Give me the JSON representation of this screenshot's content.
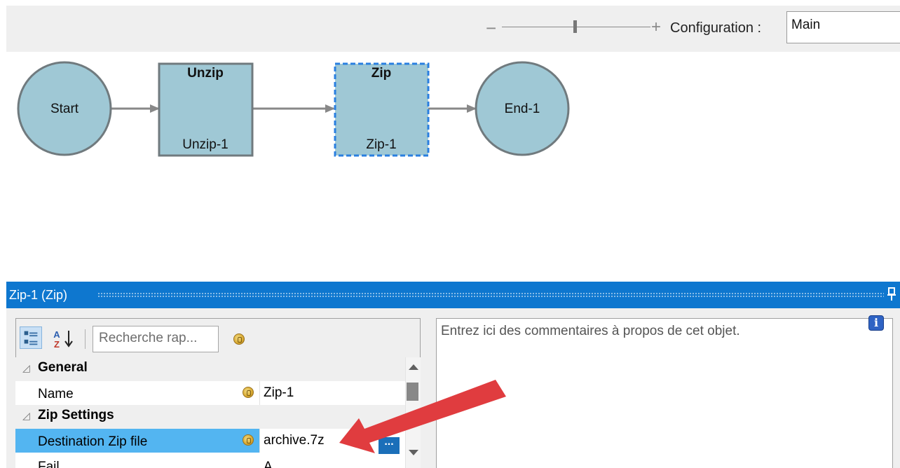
{
  "toolbar": {
    "zoom_minus": "−",
    "zoom_plus": "+",
    "configuration_label": "Configuration :",
    "configuration_value": "Main"
  },
  "diagram": {
    "nodes": [
      {
        "type": "start",
        "label": "Start"
      },
      {
        "type": "task",
        "title": "Unzip",
        "name": "Unzip-1"
      },
      {
        "type": "task",
        "title": "Zip",
        "name": "Zip-1",
        "selected": true
      },
      {
        "type": "end",
        "label": "End-1"
      }
    ],
    "colors": {
      "node_fill": "#9fc8d5",
      "node_stroke": "#707a7e",
      "edge": "#888888",
      "selection": "#2a7fe0"
    }
  },
  "panel": {
    "title": "Zip-1 (Zip)",
    "search_placeholder": "Recherche rap...",
    "comments_placeholder": "Entrez ici des commentaires à propos de cet objet.",
    "info_icon_label": "i",
    "header_color": "#0e77cf"
  },
  "properties": {
    "categories": [
      {
        "label": "General",
        "rows": [
          {
            "name": "Name",
            "value": "Zip-1"
          }
        ]
      },
      {
        "label": "Zip Settings",
        "rows": [
          {
            "name": "Destination Zip file",
            "value": "archive.7z",
            "selected": true
          },
          {
            "name": "Fail…",
            "value": "A…"
          }
        ]
      }
    ],
    "ellipsis_label": "..."
  },
  "icons": {
    "categorized": "categorized-view-icon",
    "sort": "sort-alphabetical-icon",
    "pin": "pin-icon",
    "binding": "binding-coin-icon",
    "info": "info-icon"
  }
}
